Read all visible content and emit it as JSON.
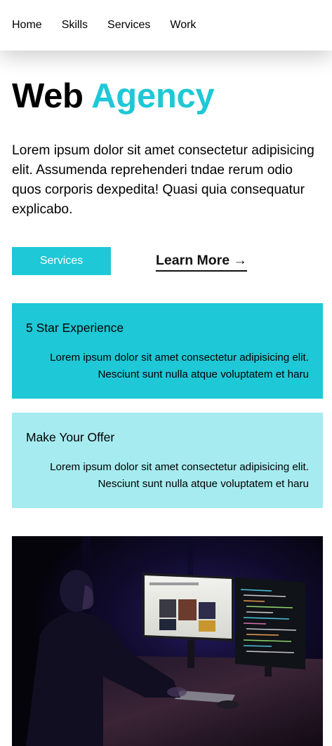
{
  "nav": {
    "items": [
      {
        "label": "Home"
      },
      {
        "label": "Skills"
      },
      {
        "label": "Services"
      },
      {
        "label": "Work"
      }
    ]
  },
  "hero": {
    "title_part1": "Web",
    "title_part2": "Agency",
    "description": "Lorem ipsum dolor sit amet consectetur adipisicing elit. Assumenda reprehenderi tndae rerum odio quos corporis dexpedita! Quasi quia consequatur explicabo."
  },
  "cta": {
    "primary_label": "Services",
    "secondary_label": "Learn More →"
  },
  "features": [
    {
      "title": "5 Star Experience",
      "line1": "Lorem ipsum dolor sit amet consectetur adipisicing elit.",
      "line2": "Nesciunt sunt nulla atque voluptatem et haru"
    },
    {
      "title": "Make Your Offer",
      "line1": "Lorem ipsum dolor sit amet consectetur adipisicing elit.",
      "line2": "Nesciunt sunt nulla atque voluptatem et haru"
    }
  ],
  "colors": {
    "accent": "#1ec8d6",
    "accent_light": "#a6ebef"
  },
  "photo": {
    "icon": "developer-at-monitors-photo"
  }
}
